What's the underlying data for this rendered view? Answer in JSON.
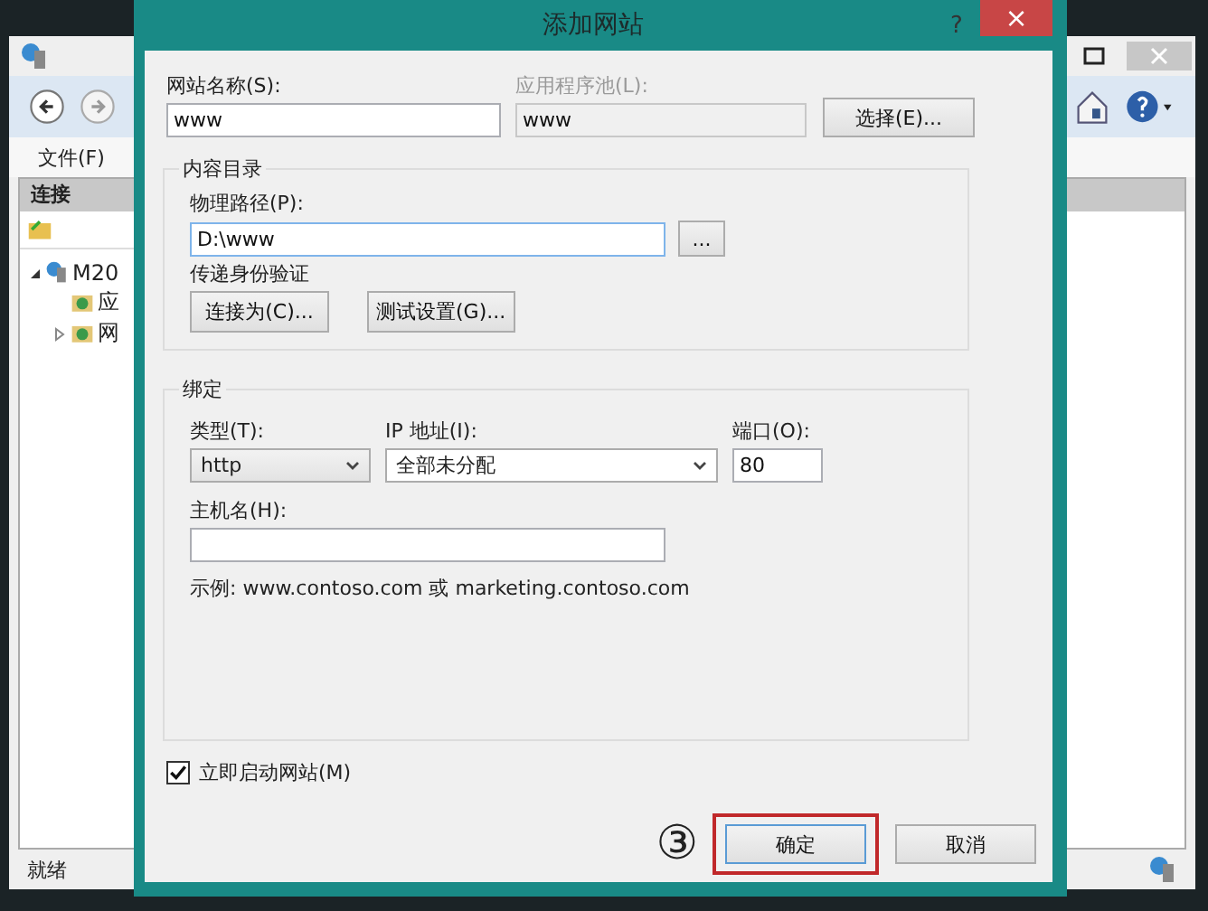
{
  "background_window": {
    "menu": [
      {
        "label": "文件(F)"
      }
    ],
    "connections_header": "连接",
    "tree": [
      {
        "label": "M20",
        "expanded": true,
        "children": [
          {
            "label": "应"
          },
          {
            "label": "网",
            "expanded": false
          }
        ]
      }
    ],
    "status": "就绪"
  },
  "dialog": {
    "title": "添加网站",
    "help": "?",
    "close": "×",
    "site_name": {
      "label": "网站名称(S):",
      "value": "www"
    },
    "app_pool": {
      "label": "应用程序池(L):",
      "value": "www",
      "disabled": true
    },
    "select_button": "选择(E)...",
    "content_directory": {
      "legend": "内容目录",
      "physical_path": {
        "label": "物理路径(P):",
        "value": "D:\\www"
      },
      "browse_button": "...",
      "auth_label": "传递身份验证",
      "buttons": [
        {
          "label": "连接为(C)..."
        },
        {
          "label": "测试设置(G)..."
        }
      ]
    },
    "binding": {
      "legend": "绑定",
      "type": {
        "label": "类型(T):",
        "value": "http"
      },
      "ip": {
        "label": "IP 地址(I):",
        "value": "全部未分配"
      },
      "port": {
        "label": "端口(O):",
        "value": "80"
      },
      "host": {
        "label": "主机名(H):"
      },
      "example": "示例: www.contoso.com 或 marketing.contoso.com"
    },
    "start_now": {
      "label": "立即启动网站(M)",
      "checked": true
    },
    "annotation": "③",
    "buttons": [
      {
        "label": "确定",
        "highlighted": true
      },
      {
        "label": "取消",
        "highlighted": false
      }
    ]
  }
}
